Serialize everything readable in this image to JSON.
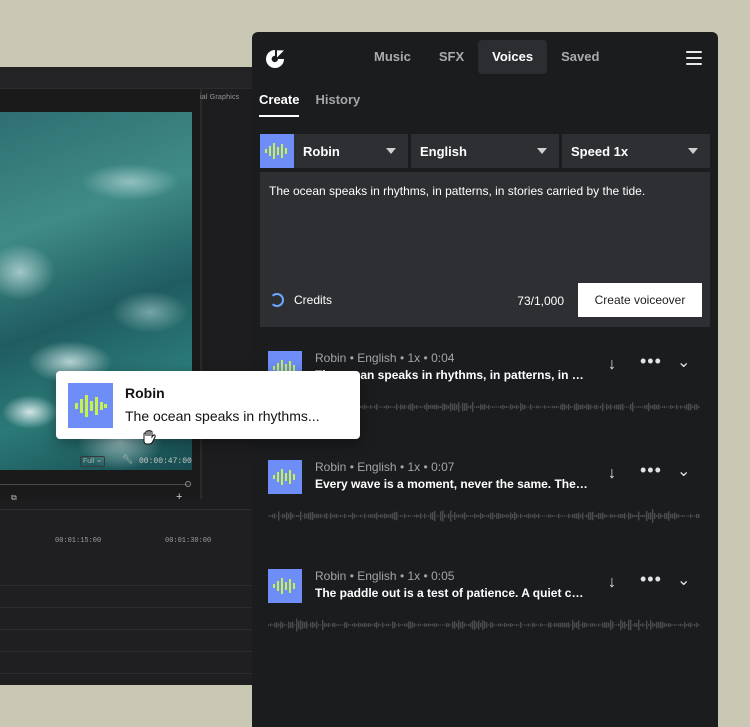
{
  "editor": {
    "panel_label": "ial Graphics",
    "zoom_select": "Full",
    "timecode": "00:00:47:00",
    "ruler": [
      "00:01:15:00",
      "00:01:30:00"
    ]
  },
  "panel": {
    "nav_tabs": [
      {
        "label": "Music",
        "active": false
      },
      {
        "label": "SFX",
        "active": false
      },
      {
        "label": "Voices",
        "active": true
      },
      {
        "label": "Saved",
        "active": false
      }
    ],
    "subtabs": [
      {
        "label": "Create",
        "active": true
      },
      {
        "label": "History",
        "active": false
      }
    ],
    "selectors": {
      "voice": "Robin",
      "language": "English",
      "speed": "Speed 1x"
    },
    "composer": {
      "script": "The ocean speaks in rhythms, in patterns, in stories carried by the tide.",
      "credits_label": "Credits",
      "char_count": "73/1,000",
      "create_label": "Create voiceover"
    },
    "history": [
      {
        "voice": "Robin",
        "language": "English",
        "speed": "1x",
        "duration": "0:04",
        "snippet": "The ocean speaks in rhythms, in patterns, in stories carried by the tide."
      },
      {
        "voice": "Robin",
        "language": "English",
        "speed": "1x",
        "duration": "0:07",
        "snippet": "Every wave is a moment, never the same. The…"
      },
      {
        "voice": "Robin",
        "language": "English",
        "speed": "1x",
        "duration": "0:05",
        "snippet": "The paddle out is a test of patience. A quiet co…"
      }
    ],
    "separator": "•"
  },
  "drag_card": {
    "title": "Robin",
    "snippet": "The ocean speaks in rhythms..."
  },
  "colors": {
    "accent_thumb": "#6e8df7",
    "waveform_glyph": "#c6f24a",
    "panel_bg": "#1b1c1e",
    "field_bg": "#2d2f32",
    "backdrop": "#c9c8b4"
  },
  "icons": [
    "logo-icon",
    "menu-icon",
    "caret-down-icon",
    "credits-spinner-icon",
    "download-icon",
    "more-icon",
    "chevron-down-icon",
    "waveform-icon",
    "grab-hand-icon"
  ]
}
